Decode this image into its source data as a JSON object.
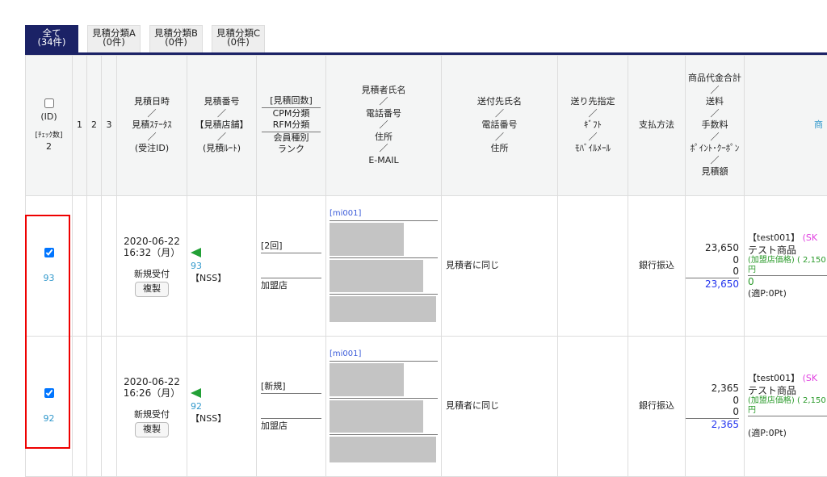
{
  "tabs": [
    {
      "label": "全て",
      "count": "(34件)",
      "active": true
    },
    {
      "label": "見積分類A",
      "count": "(0件)"
    },
    {
      "label": "見積分類B",
      "count": "(0件)"
    },
    {
      "label": "見積分類C",
      "count": "(0件)"
    }
  ],
  "header": {
    "id": "(ID)",
    "check_count_label": "[ﾁｪｯｸ数]",
    "check_count": "2",
    "c1": "1",
    "c2": "2",
    "c3": "3",
    "datetime": [
      "見積日時",
      "／",
      "見積ｽﾃｰﾀｽ",
      "／",
      "(受注ID)"
    ],
    "number": [
      "見積番号",
      "／",
      "【見積店舗】",
      "／",
      "(見積ﾙｰﾄ)"
    ],
    "count": [
      "[見積回数]",
      "CPM分類",
      "RFM分類",
      "会員種別",
      "ランク"
    ],
    "customer": [
      "見積者氏名",
      "／",
      "電話番号",
      "／",
      "住所",
      "／",
      "E-MAIL"
    ],
    "ship": [
      "送付先氏名",
      "／",
      "電話番号",
      "／",
      "住所"
    ],
    "dest": [
      "送り先指定",
      "／",
      "ｷﾞﾌﾄ",
      "／",
      "ﾓﾊﾞｲﾙﾒｰﾙ"
    ],
    "payment": "支払方法",
    "amount": [
      "商品代金合計",
      "／",
      "送料",
      "／",
      "手数料",
      "／",
      "ﾎﾟｲﾝﾄ･ｸｰﾎﾟﾝ",
      "／",
      "見積額"
    ],
    "product": "商"
  },
  "rows": [
    {
      "id": "93",
      "date": "2020-06-22",
      "time": "16:32（月）",
      "status": "新規受付",
      "copy": "複製",
      "num": "93",
      "store": "【NSS】",
      "times": "[2回]",
      "member": "加盟店",
      "cust_id": "[mi001]",
      "ship": "見積者に同じ",
      "payment": "銀行振込",
      "subtotal": "23,650",
      "shipping": "0",
      "fee": "0",
      "total": "23,650",
      "prod_code": "【test001】",
      "sku": "(SK",
      "prod_name": "テスト商品",
      "price": "(加盟店価格) ( 2,150円",
      "green": "0",
      "pt": "(適P:0Pt)"
    },
    {
      "id": "92",
      "date": "2020-06-22",
      "time": "16:26（月）",
      "status": "新規受付",
      "copy": "複製",
      "num": "92",
      "store": "【NSS】",
      "times": "[新規]",
      "member": "加盟店",
      "cust_id": "[mi001]",
      "ship": "見積者に同じ",
      "payment": "銀行振込",
      "subtotal": "2,365",
      "shipping": "0",
      "fee": "0",
      "total": "2,365",
      "prod_code": "【test001】",
      "sku": "(SK",
      "prod_name": "テスト商品",
      "price": "(加盟店価格) ( 2,150円",
      "green": "",
      "pt": "(適P:0Pt)"
    }
  ]
}
